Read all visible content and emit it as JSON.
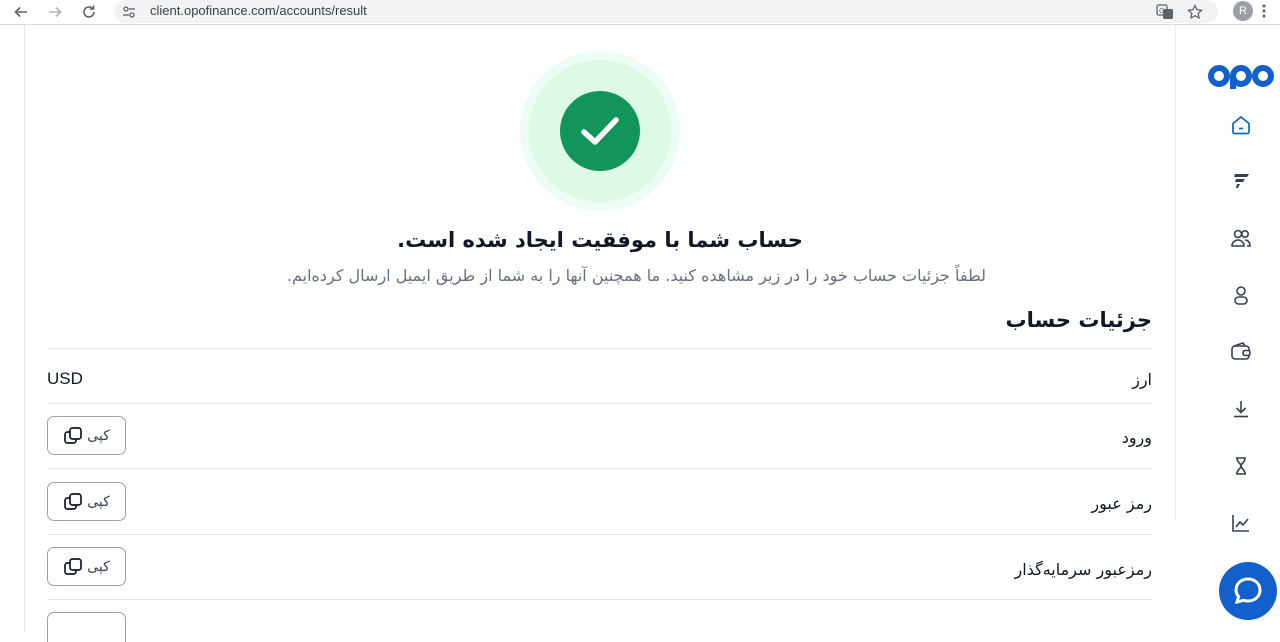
{
  "browser": {
    "url": "client.opofinance.com/accounts/result",
    "profile_initial": "R"
  },
  "result": {
    "title": "حساب شما با موفقیت ایجاد شده است.",
    "subtitle": "لطفاً جزئیات حساب خود را در زیر مشاهده کنید. ما همچنین آنها را به شما از طریق ایمیل ارسال کرده‌ایم."
  },
  "details": {
    "section_title": "جزئیات حساب",
    "copy_label": "کپی",
    "rows": [
      {
        "label": "ارز",
        "value": "USD"
      },
      {
        "label": "ورود",
        "value": ""
      },
      {
        "label": "رمز عبور",
        "value": ""
      },
      {
        "label": "رمزعبور سرمایه‌گذار",
        "value": ""
      }
    ]
  },
  "sidebar": {
    "logo_text": "opo",
    "items": [
      "home-icon",
      "trade-icon",
      "users-icon",
      "profile-icon",
      "wallet-icon",
      "download-icon",
      "hourglass-icon",
      "chart-icon"
    ]
  },
  "colors": {
    "success": "#13945a",
    "brand": "#1260cc",
    "text_primary": "#101828",
    "text_secondary": "#667085"
  }
}
